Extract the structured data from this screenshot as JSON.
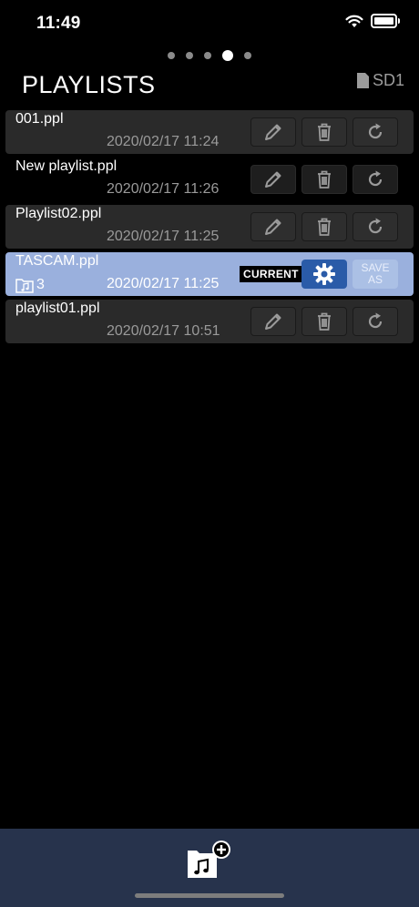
{
  "status": {
    "time": "11:49"
  },
  "header": {
    "title": "PLAYLISTS",
    "storage": "SD1"
  },
  "pages": {
    "count": 5,
    "active": 3
  },
  "playlists": [
    {
      "name": "001.ppl",
      "date": "2020/02/17 11:24",
      "style": "dark"
    },
    {
      "name": "New playlist.ppl",
      "date": "2020/02/17 11:26",
      "style": "plain"
    },
    {
      "name": "Playlist02.ppl",
      "date": "2020/02/17 11:25",
      "style": "dark"
    },
    {
      "name": "TASCAM.ppl",
      "date": "2020/02/17 11:25",
      "style": "current",
      "count": "3"
    },
    {
      "name": "playlist01.ppl",
      "date": "2020/02/17 10:51",
      "style": "dark"
    }
  ],
  "current_row": {
    "badge": "CURRENT",
    "save_as_line1": "SAVE",
    "save_as_line2": "AS"
  },
  "icons": {
    "edit": "pencil-icon",
    "delete": "trash-icon",
    "reload": "reload-icon",
    "settings": "gear-icon",
    "add": "add-playlist-icon"
  },
  "colors": {
    "current_row": "#9ab0dd",
    "gear_button": "#2a5ba8",
    "bottom_bar": "#27334c"
  }
}
